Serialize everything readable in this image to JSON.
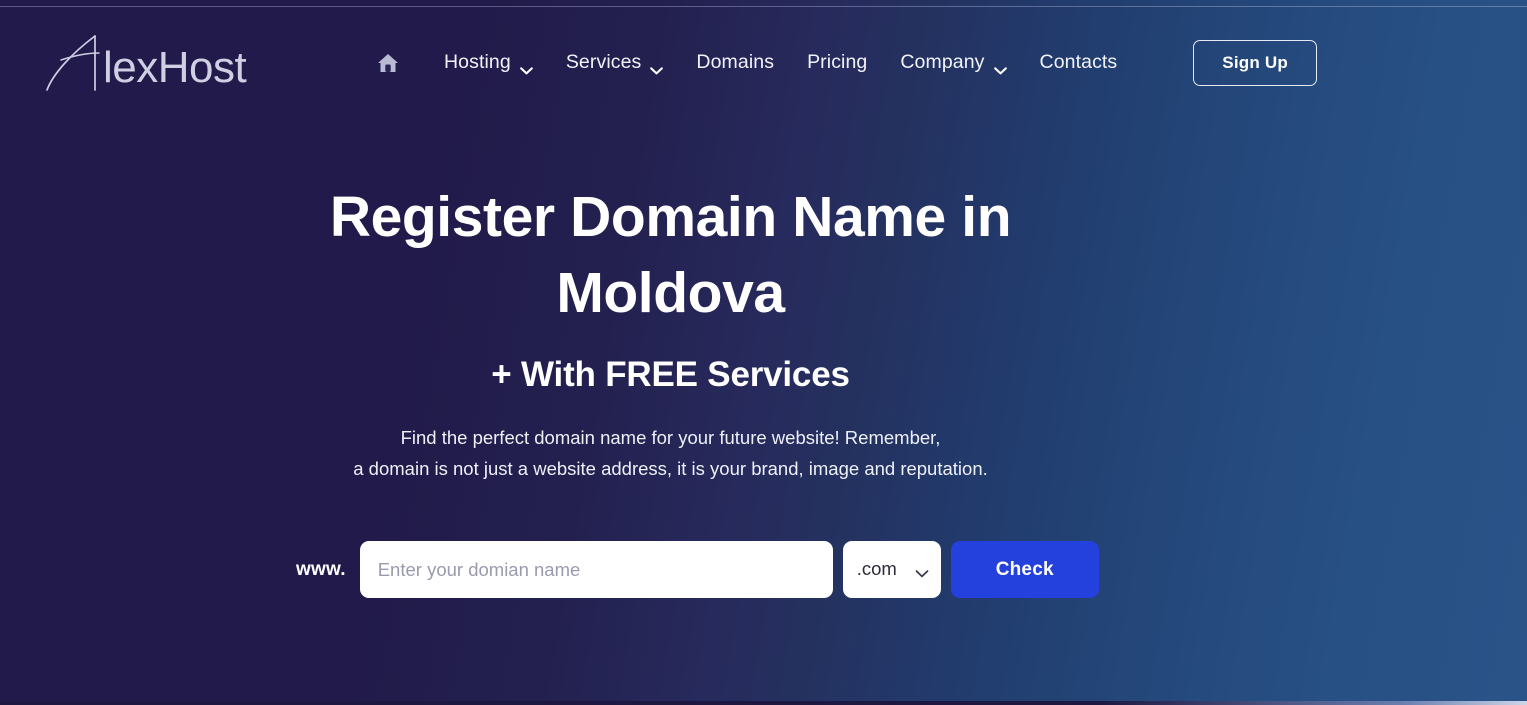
{
  "brand": {
    "name": "AlexHost",
    "logo_text": "AlexHost"
  },
  "header": {
    "home_icon_name": "home-icon",
    "nav_items": [
      {
        "label": "Hosting",
        "has_dropdown": true
      },
      {
        "label": "Services",
        "has_dropdown": true
      },
      {
        "label": "Domains",
        "has_dropdown": false
      },
      {
        "label": "Pricing",
        "has_dropdown": false
      },
      {
        "label": "Company",
        "has_dropdown": true
      },
      {
        "label": "Contacts",
        "has_dropdown": false
      }
    ],
    "signup_label": "Sign Up"
  },
  "hero": {
    "title": "Register Domain Name in Moldova",
    "subtitle": "+ With FREE Services",
    "description_line1": "Find the perfect domain name for your future website! Remember,",
    "description_line2": "a domain is not just a website address, it is your brand, image and reputation."
  },
  "search": {
    "prefix_label": "www.",
    "input_value": "",
    "input_placeholder": "Enter your domian name",
    "tld_selected": ".com",
    "tld_options": [
      ".com"
    ],
    "check_label": "Check"
  },
  "colors": {
    "bg_left": "#211a4a",
    "bg_right": "#2a5489",
    "accent_blue": "#2440dd",
    "text_white": "#ffffff",
    "placeholder_gray": "#9a9aae"
  }
}
